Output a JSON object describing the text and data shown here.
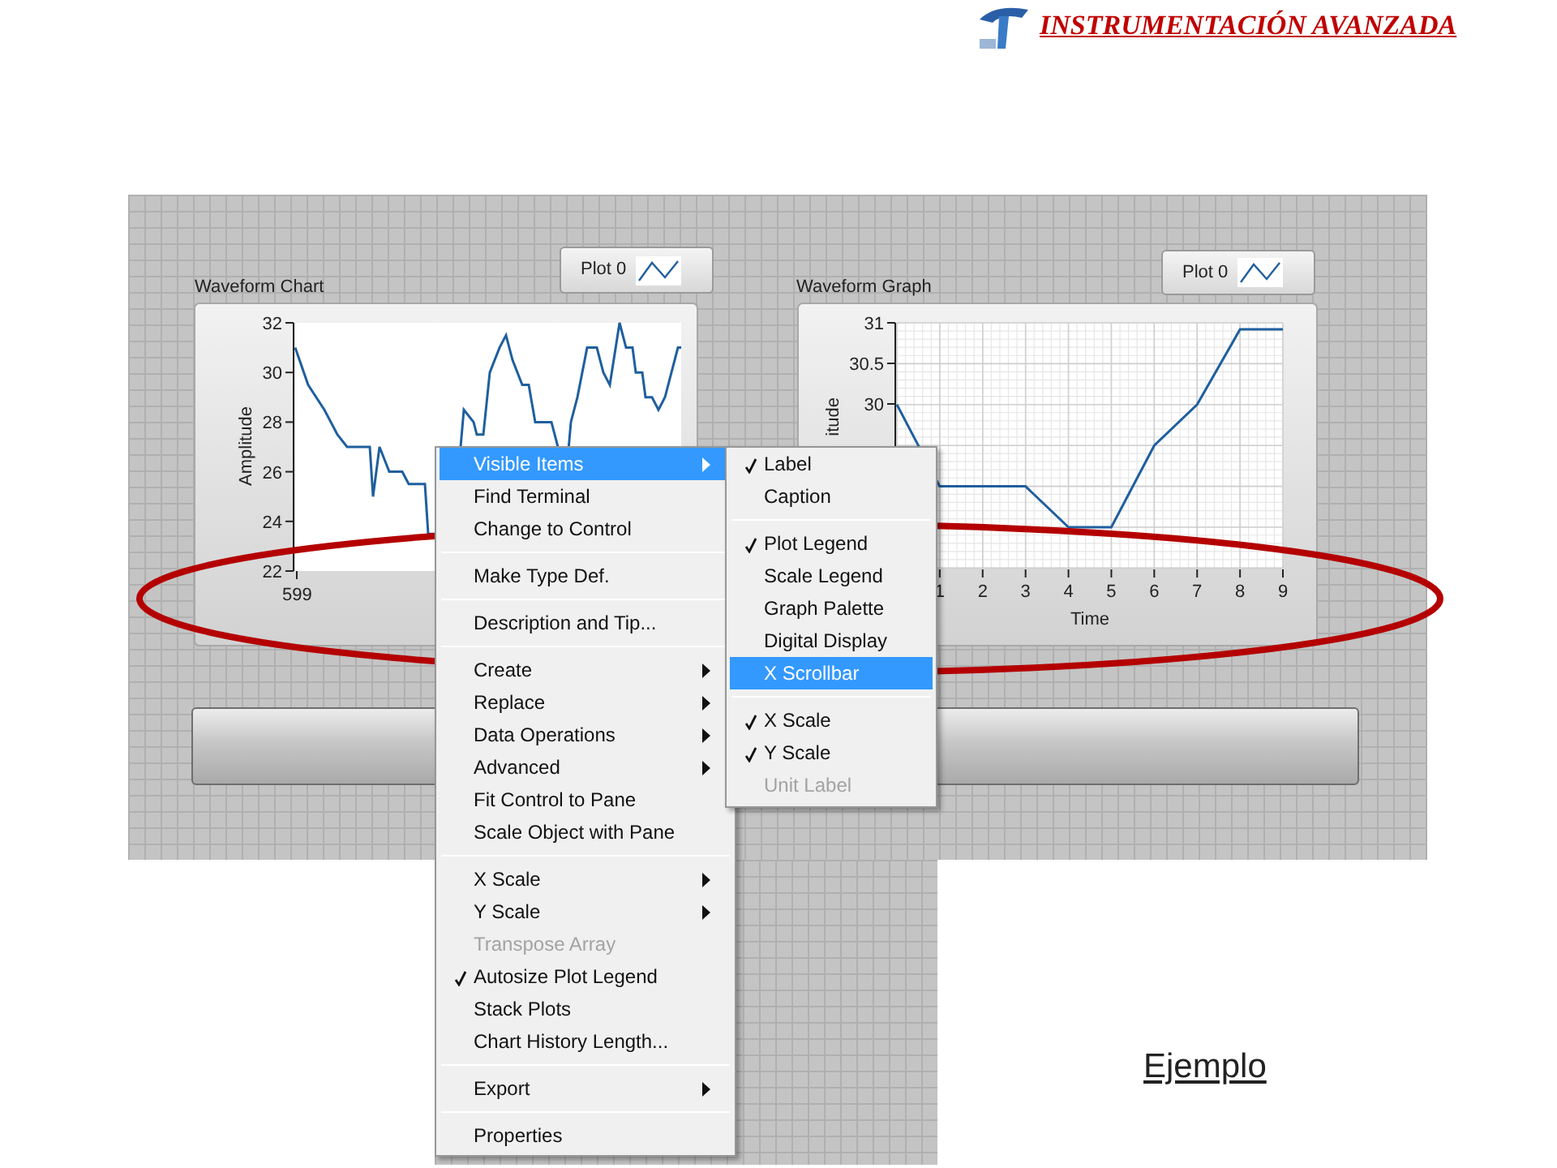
{
  "header": {
    "title": "INSTRUMENTACIÓN AVANZADA"
  },
  "front_panel": {
    "waveform_chart": {
      "label": "Waveform Chart",
      "legend": "Plot 0",
      "ylabel": "Amplitude",
      "yticks": [
        "32",
        "30",
        "28",
        "26",
        "24",
        "22"
      ],
      "xticks": [
        "599"
      ]
    },
    "waveform_graph": {
      "label": "Waveform Graph",
      "legend": "Plot 0",
      "ylabel": "itude",
      "yticks": [
        "31",
        "30.5",
        "30"
      ],
      "xticks": [
        "1",
        "2",
        "3",
        "4",
        "5",
        "6",
        "7",
        "8",
        "9"
      ],
      "xlabel": "Time"
    }
  },
  "context_menu": {
    "groups": [
      [
        {
          "label": "Visible Items",
          "selected": true,
          "checked": false,
          "disabled": false,
          "has_submenu": true
        },
        {
          "label": "Find Terminal",
          "selected": false,
          "checked": false,
          "disabled": false,
          "has_submenu": false
        },
        {
          "label": "Change to Control",
          "selected": false,
          "checked": false,
          "disabled": false,
          "has_submenu": false
        }
      ],
      [
        {
          "label": "Make Type Def.",
          "selected": false,
          "checked": false,
          "disabled": false,
          "has_submenu": false
        }
      ],
      [
        {
          "label": "Description and Tip...",
          "selected": false,
          "checked": false,
          "disabled": false,
          "has_submenu": false
        }
      ],
      [
        {
          "label": "Create",
          "selected": false,
          "checked": false,
          "disabled": false,
          "has_submenu": true
        },
        {
          "label": "Replace",
          "selected": false,
          "checked": false,
          "disabled": false,
          "has_submenu": true
        },
        {
          "label": "Data Operations",
          "selected": false,
          "checked": false,
          "disabled": false,
          "has_submenu": true
        },
        {
          "label": "Advanced",
          "selected": false,
          "checked": false,
          "disabled": false,
          "has_submenu": true
        },
        {
          "label": "Fit Control to Pane",
          "selected": false,
          "checked": false,
          "disabled": false,
          "has_submenu": false
        },
        {
          "label": "Scale Object with Pane",
          "selected": false,
          "checked": false,
          "disabled": false,
          "has_submenu": false
        }
      ],
      [
        {
          "label": "X Scale",
          "selected": false,
          "checked": false,
          "disabled": false,
          "has_submenu": true
        },
        {
          "label": "Y Scale",
          "selected": false,
          "checked": false,
          "disabled": false,
          "has_submenu": true
        },
        {
          "label": "Transpose Array",
          "selected": false,
          "checked": false,
          "disabled": true,
          "has_submenu": false
        },
        {
          "label": "Autosize Plot Legend",
          "selected": false,
          "checked": true,
          "disabled": false,
          "has_submenu": false
        },
        {
          "label": "Stack Plots",
          "selected": false,
          "checked": false,
          "disabled": false,
          "has_submenu": false
        },
        {
          "label": "Chart History Length...",
          "selected": false,
          "checked": false,
          "disabled": false,
          "has_submenu": false
        }
      ],
      [
        {
          "label": "Export",
          "selected": false,
          "checked": false,
          "disabled": false,
          "has_submenu": true
        }
      ],
      [
        {
          "label": "Properties",
          "selected": false,
          "checked": false,
          "disabled": false,
          "has_submenu": false
        }
      ]
    ]
  },
  "submenu": {
    "groups": [
      [
        {
          "label": "Label",
          "selected": false,
          "checked": true,
          "disabled": false
        },
        {
          "label": "Caption",
          "selected": false,
          "checked": false,
          "disabled": false
        }
      ],
      [
        {
          "label": "Plot Legend",
          "selected": false,
          "checked": true,
          "disabled": false
        },
        {
          "label": "Scale Legend",
          "selected": false,
          "checked": false,
          "disabled": false
        },
        {
          "label": "Graph Palette",
          "selected": false,
          "checked": false,
          "disabled": false
        },
        {
          "label": "Digital Display",
          "selected": false,
          "checked": false,
          "disabled": false
        },
        {
          "label": "X Scrollbar",
          "selected": true,
          "checked": false,
          "disabled": false
        }
      ],
      [
        {
          "label": "X Scale",
          "selected": false,
          "checked": true,
          "disabled": false
        },
        {
          "label": "Y Scale",
          "selected": false,
          "checked": true,
          "disabled": false
        },
        {
          "label": "Unit Label",
          "selected": false,
          "checked": false,
          "disabled": true
        }
      ]
    ]
  },
  "caption": "Ejemplo"
}
